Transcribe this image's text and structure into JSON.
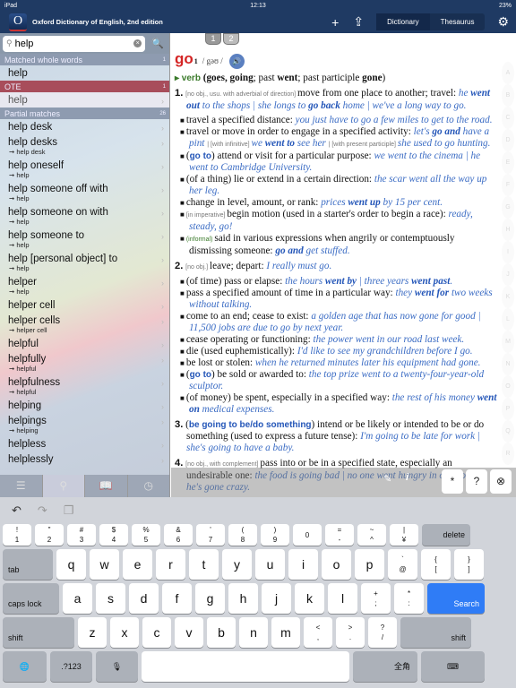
{
  "status": {
    "device": "iPad",
    "time": "12:13",
    "battery": "23%"
  },
  "header": {
    "title": "Oxford Dictionary of English, 2nd edition",
    "logo": "O",
    "tabs": [
      "Dictionary",
      "Thesaurus"
    ],
    "active_tab": "Dictionary"
  },
  "search": {
    "value": "help"
  },
  "sections": {
    "whole": {
      "label": "Matched whole words",
      "count": "1",
      "items": [
        {
          "w": "help"
        }
      ]
    },
    "ote": {
      "label": "OTE",
      "count": "1",
      "items": [
        {
          "w": "help"
        }
      ]
    },
    "partial": {
      "label": "Partial matches",
      "count": "26",
      "items": [
        {
          "w": "help desk"
        },
        {
          "w": "help desks",
          "r": "➞ help desk"
        },
        {
          "w": "help oneself",
          "r": "➞ help"
        },
        {
          "w": "help someone off with",
          "r": "➞ help"
        },
        {
          "w": "help someone on with",
          "r": "➞ help"
        },
        {
          "w": "help someone to",
          "r": "➞ help"
        },
        {
          "w": "help [personal object] to",
          "r": "➞ help"
        },
        {
          "w": "helper",
          "r": "➞ help"
        },
        {
          "w": "helper cell"
        },
        {
          "w": "helper cells",
          "r": "➞ helper cell"
        },
        {
          "w": "helpful"
        },
        {
          "w": "helpfully",
          "r": "➞ helpful"
        },
        {
          "w": "helpfulness",
          "r": "➞ helpful"
        },
        {
          "w": "helping"
        },
        {
          "w": "helpings",
          "r": "➞ helping"
        },
        {
          "w": "helpless"
        },
        {
          "w": "helplessly"
        }
      ]
    }
  },
  "entry": {
    "homographs": [
      "1",
      "2"
    ],
    "headword": "go",
    "hom": "1",
    "pron": "/ gəʊ /",
    "posline": [
      [
        "pos",
        "▸ verb"
      ],
      [
        "b",
        " (goes, going"
      ],
      [
        "",
        "; past "
      ],
      [
        "b",
        "went"
      ],
      [
        "",
        "; past participle "
      ],
      [
        "b",
        "gone"
      ],
      [
        "",
        ")"
      ]
    ],
    "senses": [
      {
        "n": "1.",
        "segs": [
          [
            "lab",
            "[no obj., usu. with adverbial of direction] "
          ],
          [
            "",
            "move from one place to another; travel: "
          ],
          [
            "ex",
            "he "
          ],
          [
            "exb",
            "went out"
          ],
          [
            "ex",
            " to the shops | she longs to "
          ],
          [
            "exb",
            "go back"
          ],
          [
            "ex",
            " home | we've a long way to go."
          ]
        ]
      },
      {
        "segs": [
          [
            "",
            "travel a specified distance: "
          ],
          [
            "ex",
            "you just have to go a few miles to get to the road."
          ]
        ]
      },
      {
        "segs": [
          [
            "",
            "travel or move in order to engage in a specified activity: "
          ],
          [
            "ex",
            "let's "
          ],
          [
            "exb",
            "go and"
          ],
          [
            "ex",
            " have a pint "
          ],
          [
            "lab",
            "| [with infinitive] "
          ],
          [
            "ex",
            "we "
          ],
          [
            "exb",
            "went to"
          ],
          [
            "ex",
            " see her "
          ],
          [
            "lab",
            "| [with present participle] "
          ],
          [
            "ex",
            "she used to go hunting."
          ]
        ]
      },
      {
        "segs": [
          [
            "",
            "("
          ],
          [
            "ph",
            "go to"
          ],
          [
            "",
            ") attend or visit for a particular purpose: "
          ],
          [
            "ex",
            "we went to the cinema | he went to Cambridge University."
          ]
        ]
      },
      {
        "segs": [
          [
            "",
            "(of a thing) lie or extend in a certain direction: "
          ],
          [
            "ex",
            "the scar went all the way up her leg."
          ]
        ]
      },
      {
        "segs": [
          [
            "",
            "change in level, amount, or rank: "
          ],
          [
            "ex",
            "prices "
          ],
          [
            "exb",
            "went up"
          ],
          [
            "ex",
            " by 15 per cent."
          ]
        ]
      },
      {
        "segs": [
          [
            "lab",
            "[in imperative] "
          ],
          [
            "",
            "begin motion (used in a starter's order to begin a race): "
          ],
          [
            "ex",
            "ready, steady, go!"
          ]
        ]
      },
      {
        "segs": [
          [
            "inf",
            "(informal) "
          ],
          [
            "",
            "said in various expressions when angrily or contemptuously dismissing someone: "
          ],
          [
            "exb",
            "go and"
          ],
          [
            "ex",
            " get stuffed."
          ]
        ]
      },
      {
        "n": "2.",
        "segs": [
          [
            "lab",
            "[no obj.] "
          ],
          [
            "",
            "leave; depart: "
          ],
          [
            "ex",
            "I really must go."
          ]
        ]
      },
      {
        "segs": [
          [
            "",
            "(of time) pass or elapse: "
          ],
          [
            "ex",
            "the hours "
          ],
          [
            "exb",
            "went by"
          ],
          [
            "ex",
            " | three years "
          ],
          [
            "exb",
            "went past"
          ],
          [
            "ex",
            "."
          ]
        ]
      },
      {
        "segs": [
          [
            "",
            "pass a specified amount of time in a particular way: "
          ],
          [
            "ex",
            "they "
          ],
          [
            "exb",
            "went for"
          ],
          [
            "ex",
            " two weeks without talking."
          ]
        ]
      },
      {
        "segs": [
          [
            "",
            "come to an end; cease to exist: "
          ],
          [
            "ex",
            "a golden age that has now gone for good | 11,500 jobs are due to go by next year."
          ]
        ]
      },
      {
        "segs": [
          [
            "",
            "cease operating or functioning: "
          ],
          [
            "ex",
            "the power went in our road last week."
          ]
        ]
      },
      {
        "segs": [
          [
            "",
            "die (used euphemistically): "
          ],
          [
            "ex",
            "I'd like to see my grandchildren before I go."
          ]
        ]
      },
      {
        "segs": [
          [
            "",
            "be lost or stolen: "
          ],
          [
            "ex",
            "when he returned minutes later his equipment had gone."
          ]
        ]
      },
      {
        "segs": [
          [
            "",
            "("
          ],
          [
            "ph",
            "go to"
          ],
          [
            "",
            ") be sold or awarded to: "
          ],
          [
            "ex",
            "the top prize went to a twenty-four-year-old sculptor."
          ]
        ]
      },
      {
        "segs": [
          [
            "",
            "(of money) be spent, especially in a specified way: "
          ],
          [
            "ex",
            "the rest of his money "
          ],
          [
            "exb",
            "went on"
          ],
          [
            "ex",
            " medical expenses."
          ]
        ]
      },
      {
        "n": "3.",
        "segs": [
          [
            "",
            "("
          ],
          [
            "ph",
            "be going to be/do something"
          ],
          [
            "",
            ") intend or be likely or intended to be or do something (used to express a future tense): "
          ],
          [
            "ex",
            "I'm going to be late for work | she's going to have a baby."
          ]
        ]
      },
      {
        "n": "4.",
        "segs": [
          [
            "lab",
            "[no obj., with complement] "
          ],
          [
            "",
            "pass into or be in a specified state, especially an undesirable one: "
          ],
          [
            "ex",
            "the food is going bad | no one went hungry in our house | he's gone crazy."
          ]
        ]
      }
    ],
    "alpha": [
      "A",
      "B",
      "C",
      "D",
      "E",
      "F",
      "G",
      "H",
      "I",
      "J",
      "K",
      "L",
      "M",
      "N",
      "O",
      "P",
      "Q",
      "R"
    ]
  },
  "tools": {
    "asterisk": "*",
    "help": "?"
  },
  "keyboard": {
    "row1": [
      [
        "!",
        "1"
      ],
      [
        "\"",
        "2"
      ],
      [
        "#",
        "3"
      ],
      [
        "$",
        "4"
      ],
      [
        "%",
        "5"
      ],
      [
        "&",
        "6"
      ],
      [
        "'",
        "7"
      ],
      [
        "(",
        "8"
      ],
      [
        ")",
        "9"
      ],
      [
        "",
        "0"
      ],
      [
        "=",
        "-"
      ],
      [
        "~",
        "^"
      ],
      [
        "|",
        "¥"
      ]
    ],
    "delete": "delete",
    "tab": "tab",
    "row2": [
      "q",
      "w",
      "e",
      "r",
      "t",
      "y",
      "u",
      "i",
      "o",
      "p"
    ],
    "row2b": [
      [
        "`",
        "@"
      ],
      [
        "{",
        "["
      ],
      [
        "}",
        "]"
      ]
    ],
    "caps": "caps lock",
    "row3": [
      "a",
      "s",
      "d",
      "f",
      "g",
      "h",
      "j",
      "k",
      "l"
    ],
    "row3b": [
      [
        "+",
        ";"
      ],
      [
        "*",
        ":"
      ]
    ],
    "search": "Search",
    "shift": "shift",
    "row4": [
      "z",
      "x",
      "c",
      "v",
      "b",
      "n",
      "m"
    ],
    "row4b": [
      [
        "<",
        ","
      ],
      [
        ">",
        "."
      ],
      [
        "?",
        "/"
      ]
    ],
    "numbers": ".?123",
    "zenkaku": "全角",
    "accent": "#2f7cf6"
  }
}
